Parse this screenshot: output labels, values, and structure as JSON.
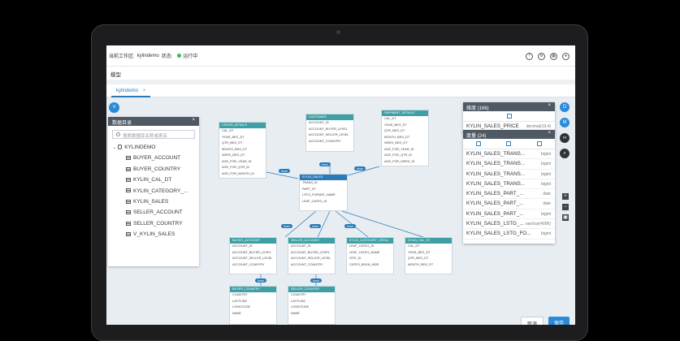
{
  "topbar": {
    "workspace_label": "当前工作区:",
    "workspace_name": "kylindemo",
    "status_label": "状态:",
    "status_value": "运行中"
  },
  "subbar": {
    "title": "模型"
  },
  "tab": {
    "label": "kylindemo",
    "close": "×"
  },
  "data_catalog": {
    "title": "数据目录",
    "close": "×",
    "search_placeholder": "搜索数据库名称或表名",
    "database": "KYLINDEMO",
    "tables": [
      "BUYER_ACCOUNT",
      "BUYER_COUNTRY",
      "KYLIN_CAL_DT",
      "KYLIN_CATEGORY_...",
      "KYLIN_SALES",
      "SELLER_ACCOUNT",
      "SELLER_COUNTRY",
      "V_KYLIN_SALES"
    ]
  },
  "entities": [
    {
      "name": "CROSS_DETAILS",
      "fields": [
        "CAL_DT",
        "YEAR_BEG_DT",
        "QTR_BEG_DT",
        "MONTH_BEG_DT",
        "WEEK_BEG_DT",
        "AGE_FOR_YEAR_ID",
        "AGE_FOR_QTR_ID",
        "AGE_FOR_MONTH_ID"
      ]
    },
    {
      "name": "CUSTOMER",
      "fields": [
        "ACCOUNT_ID",
        "ACCOUNT_BUYER_LEVEL",
        "ACCOUNT_SELLER_LEVEL",
        "ACCOUNT_COUNTRY"
      ]
    },
    {
      "name": "SHIPMENT_DETAILS",
      "fields": [
        "CAL_DT",
        "YEAR_BEG_DT",
        "QTR_BEG_DT",
        "MONTH_BEG_DT",
        "WEEK_BEG_DT",
        "AGE_FOR_YEAR_ID",
        "AGE_FOR_QTR_ID",
        "AGE_FOR_WEEK_ID"
      ]
    },
    {
      "name": "KYLIN_SALES",
      "fields": [
        "TRANS_ID",
        "PART_DT",
        "LSTG_FORMAT_NAME",
        "LEAF_CATEG_ID"
      ]
    },
    {
      "name": "BUYER_ACCOUNT",
      "fields": [
        "ACCOUNT_ID",
        "ACCOUNT_BUYER_LEVEL",
        "ACCOUNT_SELLER_LEVEL",
        "ACCOUNT_COUNTRY"
      ]
    },
    {
      "name": "SELLER_ACCOUNT",
      "fields": [
        "ACCOUNT_ID",
        "ACCOUNT_BUYER_LEVEL",
        "ACCOUNT_SELLER_LEVEL",
        "ACCOUNT_COUNTRY"
      ]
    },
    {
      "name": "KYLIN_CATEGORY_GROU...",
      "fields": [
        "LEAF_CATEG_ID",
        "LEAF_CATEG_NAME",
        "SITE_ID",
        "CATEG_BUSN_MGR"
      ]
    },
    {
      "name": "KYLIN_CAL_DT",
      "fields": [
        "CAL_DT",
        "YEAR_BEG_DT",
        "QTR_BEG_DT",
        "MONTH_BEG_DT"
      ]
    },
    {
      "name": "BUYER_COUNTRY",
      "fields": [
        "COUNTRY",
        "LATITUDE",
        "LONGITUDE",
        "NAME"
      ]
    },
    {
      "name": "SELLER_COUNTRY",
      "fields": [
        "COUNTRY",
        "LATITUDE",
        "LONGITUDE",
        "NAME"
      ]
    }
  ],
  "link_labels": [
    "Inner",
    "Inner",
    "Inner",
    "Inner",
    "Inner",
    "Inner",
    "Inner",
    "Inner"
  ],
  "dimensions_panel": {
    "title": "维度 (166)",
    "close": "×",
    "rows": [
      {
        "name": "KYLIN_SALES_PRICE",
        "type": "decimal(19,4)"
      }
    ]
  },
  "measures_panel": {
    "title": "度量 (24)",
    "close": "×",
    "rows": [
      {
        "name": "KYLIN_SALES_TRANS...",
        "type": "bigint"
      },
      {
        "name": "KYLIN_SALES_TRANS...",
        "type": "bigint"
      },
      {
        "name": "KYLIN_SALES_TRANS...",
        "type": "bigint"
      },
      {
        "name": "KYLIN_SALES_TRANS...",
        "type": "bigint"
      },
      {
        "name": "KYLIN_SALES_PART_...",
        "type": "date"
      },
      {
        "name": "KYLIN_SALES_PART_...",
        "type": "date"
      },
      {
        "name": "KYLIN_SALES_PART_...",
        "type": "bigint"
      },
      {
        "name": "KYLIN_SALES_LSTG_...",
        "type": "varchar(4096)"
      },
      {
        "name": "KYLIN_SALES_LSTG_FO...",
        "type": "bigint"
      }
    ]
  },
  "side_buttons": [
    "D",
    "M",
    "∞",
    ""
  ],
  "footer": {
    "cancel": "取消",
    "save": "保存"
  },
  "colors": {
    "accent": "#2a8ad8",
    "table_header": "#3e9fa5",
    "panel_header": "#4f5964"
  }
}
